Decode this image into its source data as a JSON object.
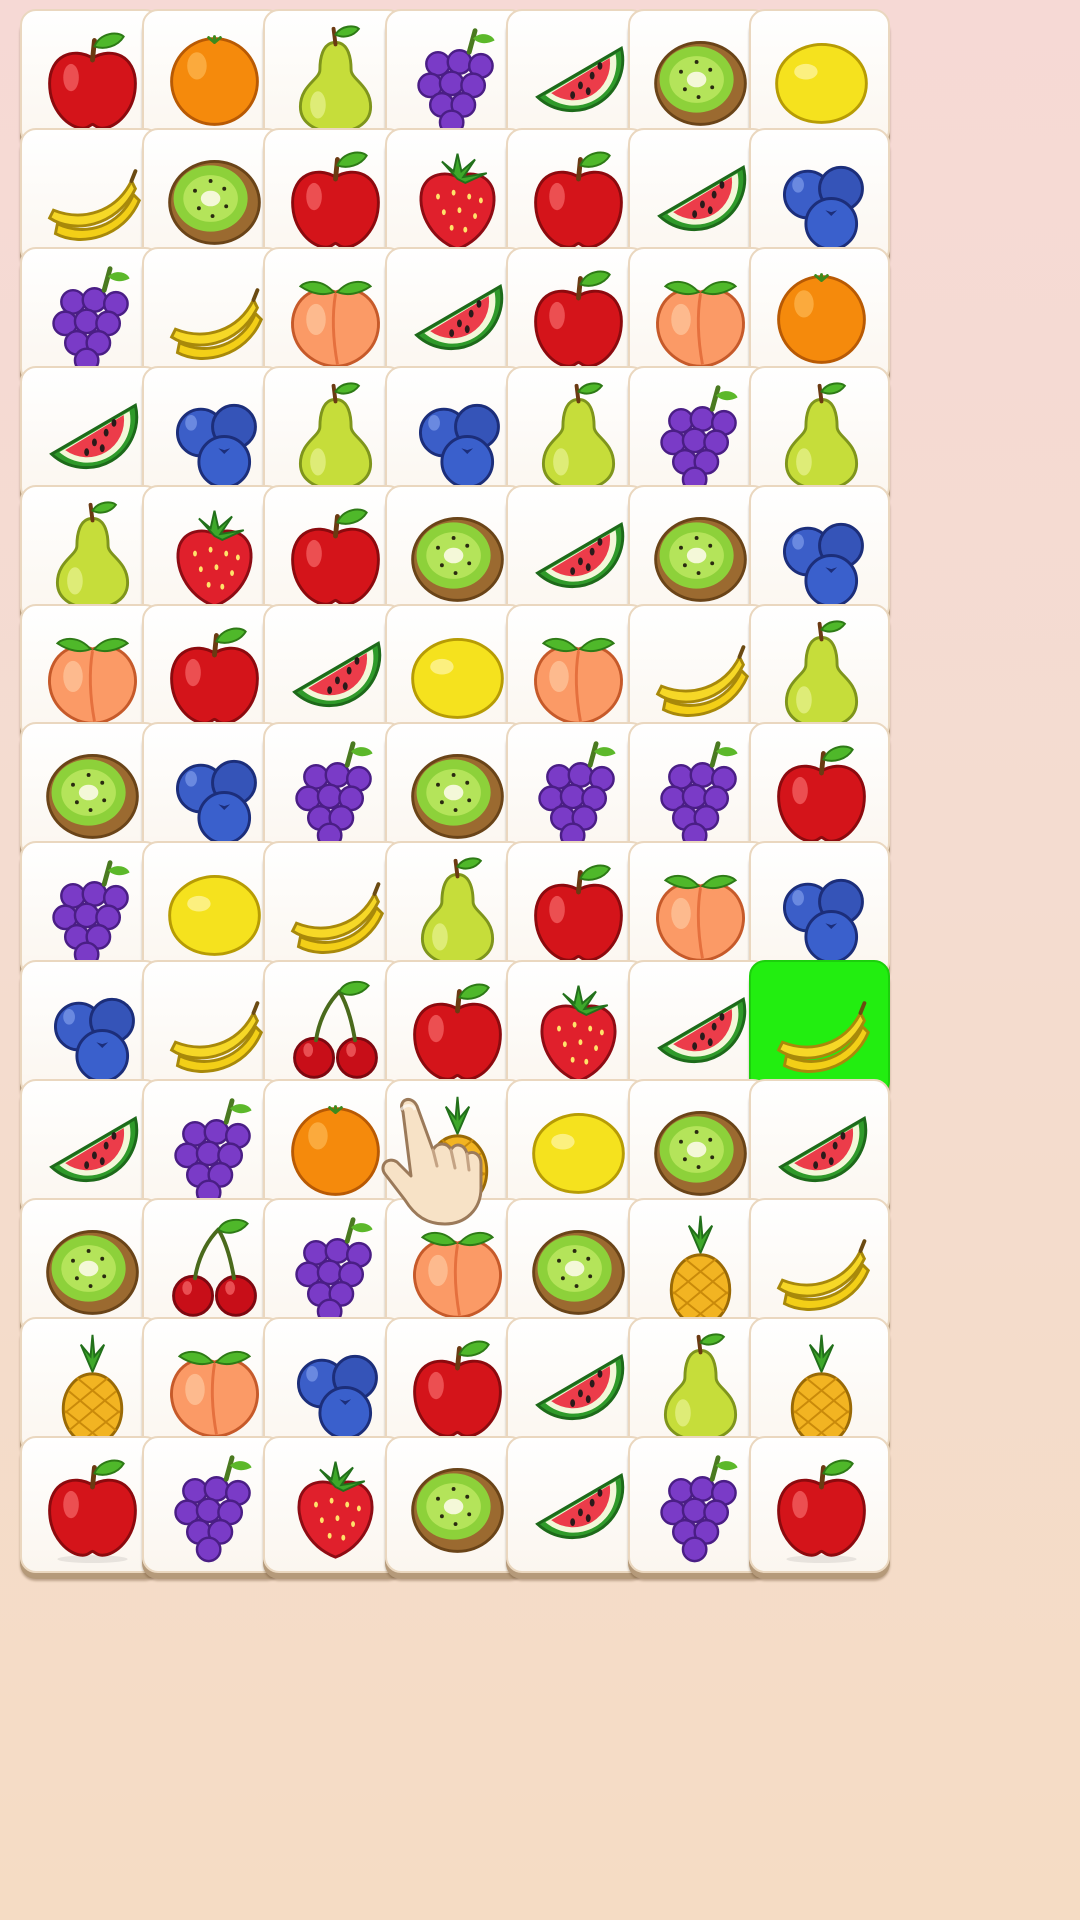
{
  "game": {
    "type": "fruit tile matching board",
    "rows": 13,
    "cols": 7,
    "selected_tile": {
      "row": 8,
      "col": 6,
      "fruit": "banana"
    },
    "selected_color": "#22ee10",
    "tutorial_hint": {
      "icon": "pointing-hand-icon",
      "target": {
        "row": 7,
        "col": 2
      }
    }
  },
  "board": [
    [
      "apple",
      "orange",
      "pear",
      "grapes",
      "watermelon",
      "kiwi",
      "lemon"
    ],
    [
      "banana",
      "kiwi",
      "apple",
      "strawberry",
      "apple",
      "watermelon",
      "blueberry"
    ],
    [
      "grapes",
      "banana",
      "peach",
      "watermelon",
      "apple",
      "peach",
      "orange"
    ],
    [
      "watermelon",
      "blueberry",
      "pear",
      "blueberry",
      "pear",
      "grapes",
      "pear"
    ],
    [
      "pear",
      "strawberry",
      "apple",
      "kiwi",
      "watermelon",
      "kiwi",
      "blueberry"
    ],
    [
      "peach",
      "apple",
      "watermelon",
      "lemon",
      "peach",
      "banana",
      "pear"
    ],
    [
      "kiwi",
      "blueberry",
      "grapes",
      "kiwi",
      "grapes",
      "grapes",
      "apple"
    ],
    [
      "grapes",
      "lemon",
      "banana",
      "pear",
      "apple",
      "peach",
      "blueberry"
    ],
    [
      "blueberry",
      "banana",
      "cherry",
      "apple",
      "strawberry",
      "watermelon",
      "banana"
    ],
    [
      "watermelon",
      "grapes",
      "orange",
      "pineapple",
      "lemon",
      "kiwi",
      "watermelon"
    ],
    [
      "kiwi",
      "cherry",
      "grapes",
      "peach",
      "kiwi",
      "pineapple",
      "banana"
    ],
    [
      "pineapple",
      "peach",
      "blueberry",
      "apple",
      "watermelon",
      "pear",
      "pineapple"
    ],
    [
      "apple",
      "grapes",
      "strawberry",
      "kiwi",
      "watermelon",
      "grapes",
      "apple"
    ]
  ]
}
